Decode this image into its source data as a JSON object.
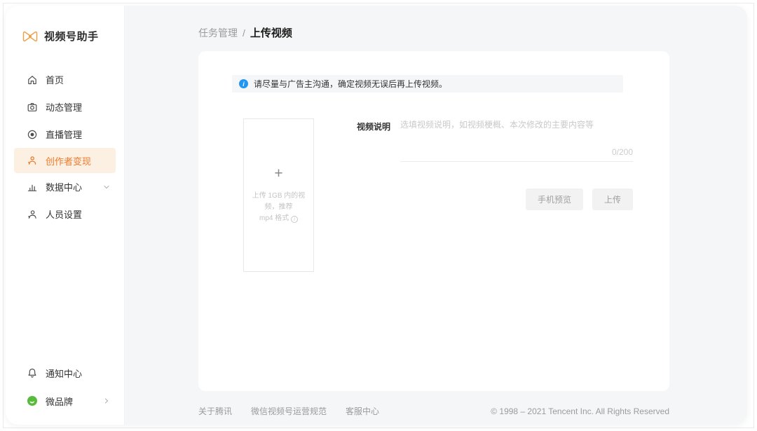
{
  "app": {
    "title": "视频号助手"
  },
  "sidebar": {
    "items": [
      {
        "label": "首页"
      },
      {
        "label": "动态管理"
      },
      {
        "label": "直播管理"
      },
      {
        "label": "创作者变现"
      },
      {
        "label": "数据中心"
      },
      {
        "label": "人员设置"
      }
    ],
    "bottom_items": [
      {
        "label": "通知中心"
      },
      {
        "label": "微品牌"
      }
    ]
  },
  "breadcrumb": {
    "parent": "任务管理",
    "separator": "/",
    "current": "上传视频"
  },
  "notice": {
    "text": "请尽量与广告主沟通，确定视频无误后再上传视频。"
  },
  "upload": {
    "plus": "+",
    "hint_line1": "上传 1GB 内的视频，推荐",
    "hint_line2": "mp4 格式",
    "info_glyph": "i"
  },
  "form": {
    "label": "视频说明",
    "placeholder": "选填视频说明，如视频梗概、本次修改的主要内容等",
    "counter": "0/200",
    "preview_button": "手机预览",
    "upload_button": "上传"
  },
  "footer": {
    "links": [
      "关于腾讯",
      "微信视频号运营规范",
      "客服中心"
    ],
    "copyright": "© 1998 – 2021 Tencent Inc. All Rights Reserved"
  },
  "colors": {
    "accent": "#ed7b2f",
    "accent_bg": "#fcf0e2",
    "info_blue": "#2196f3",
    "brand_green": "#57bb3c",
    "logo_orange": "#ef9c43"
  }
}
